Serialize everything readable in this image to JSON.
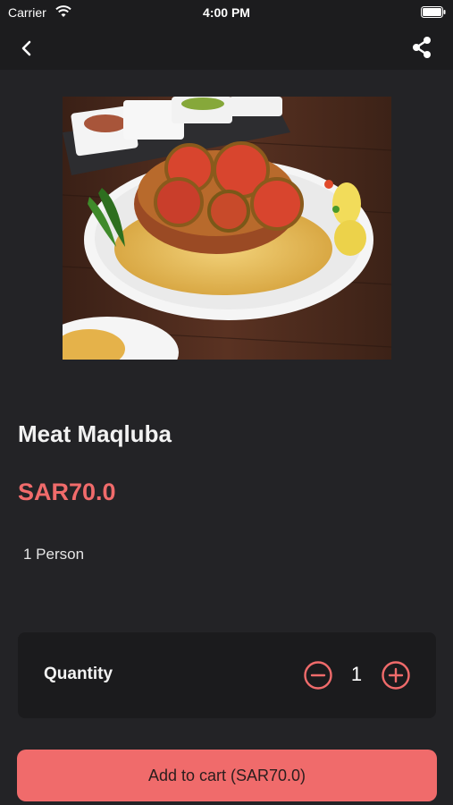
{
  "status": {
    "carrier": "Carrier",
    "time": "4:00 PM"
  },
  "nav": {
    "back_icon": "chevron-left-icon",
    "share_icon": "share-icon"
  },
  "product": {
    "name": "Meat Maqluba",
    "price": "SAR70.0",
    "serving": "1 Person"
  },
  "quantity": {
    "label": "Quantity",
    "value": "1"
  },
  "cart": {
    "button_label": "Add to cart (SAR70.0)"
  },
  "colors": {
    "accent": "#f06b6b",
    "background": "#232326",
    "card": "#1b1b1d"
  }
}
